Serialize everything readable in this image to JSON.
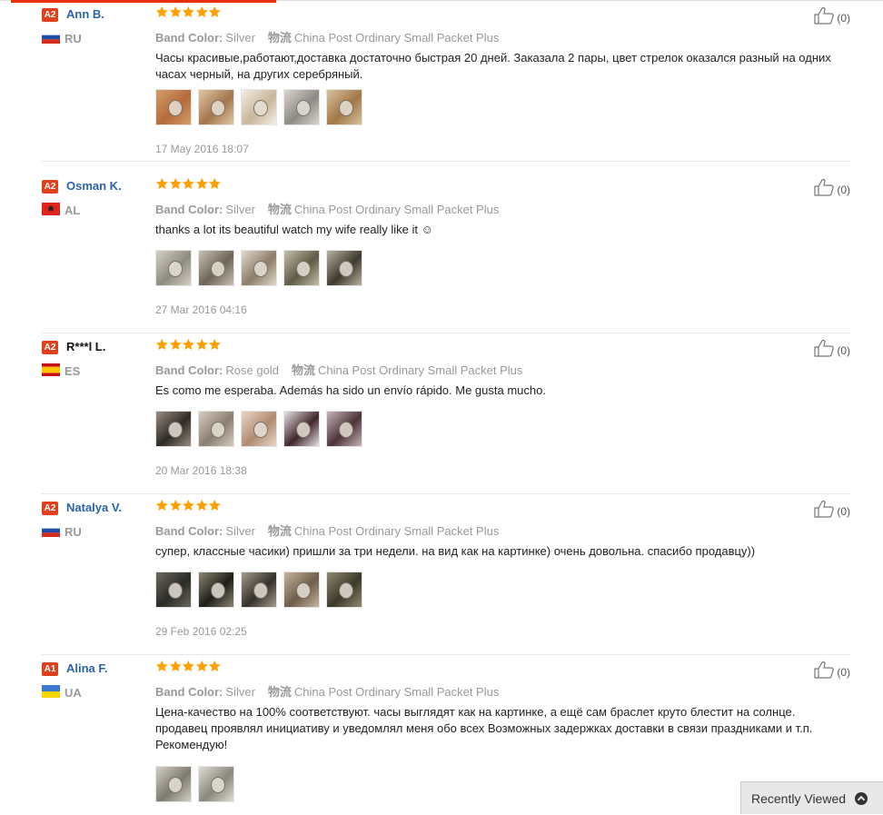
{
  "colors": {
    "accent": "#e62e04",
    "star": "#ffa000",
    "link": "#2a64a8"
  },
  "reviews": [
    {
      "level": "A2",
      "name": "Ann B.",
      "country": "RU",
      "flag": "ru",
      "rating": 5,
      "band_label": "Band Color:",
      "band_value": "Silver",
      "ship_label": "物流",
      "ship_value": "China Post Ordinary Small Packet Plus",
      "text": "Часы красивые,работают,доставка достаточно быстрая 20 дней. Заказала 2 пары, цвет стрелок оказался разный на одних часах черный, на других серебряный.",
      "photos": 5,
      "date": "17 May 2016 18:07",
      "likes": "(0)"
    },
    {
      "level": "A2",
      "name": "Osman K.",
      "country": "AL",
      "flag": "al",
      "rating": 5,
      "band_label": "Band Color:",
      "band_value": "Silver",
      "ship_label": "物流",
      "ship_value": "China Post Ordinary Small Packet Plus",
      "text": "thanks a lot its beautiful watch my wife really like it ☺",
      "photos": 5,
      "date": "27 Mar 2016 04:16",
      "likes": "(0)"
    },
    {
      "level": "A2",
      "name": "R***l L.",
      "country": "ES",
      "flag": "es",
      "rating": 5,
      "band_label": "Band Color:",
      "band_value": "Rose gold",
      "ship_label": "物流",
      "ship_value": "China Post Ordinary Small Packet Plus",
      "text": "Es como me esperaba. Además ha sido un envío rápido. Me gusta mucho.",
      "photos": 5,
      "date": "20 Mar 2016 18:38",
      "likes": "(0)"
    },
    {
      "level": "A2",
      "name": "Natalya V.",
      "country": "RU",
      "flag": "ru",
      "rating": 5,
      "band_label": "Band Color:",
      "band_value": "Silver",
      "ship_label": "物流",
      "ship_value": "China Post Ordinary Small Packet Plus",
      "text": "супер, классные часики) пришли за три недели. на вид как на картинке) очень довольна. спасибо продавцу))",
      "photos": 5,
      "date": "29 Feb 2016 02:25",
      "likes": "(0)"
    },
    {
      "level": "A1",
      "name": "Alina F.",
      "country": "UA",
      "flag": "ua",
      "rating": 5,
      "band_label": "Band Color:",
      "band_value": "Silver",
      "ship_label": "物流",
      "ship_value": "China Post Ordinary Small Packet Plus",
      "text": "Цена-качество на 100% соответствуют. часы выглядят как на картинке, а ещё сам браслет круто блестит на солнце. продавец проявлял инициативу и уведомлял меня обо всех Возможных задержках доставки в связи праздниками и т.п. Рекомендую!",
      "photos": 2,
      "date": "",
      "likes": "(0)"
    }
  ],
  "recently_viewed": {
    "label": "Recently Viewed",
    "icon": "chevron-up-icon"
  }
}
